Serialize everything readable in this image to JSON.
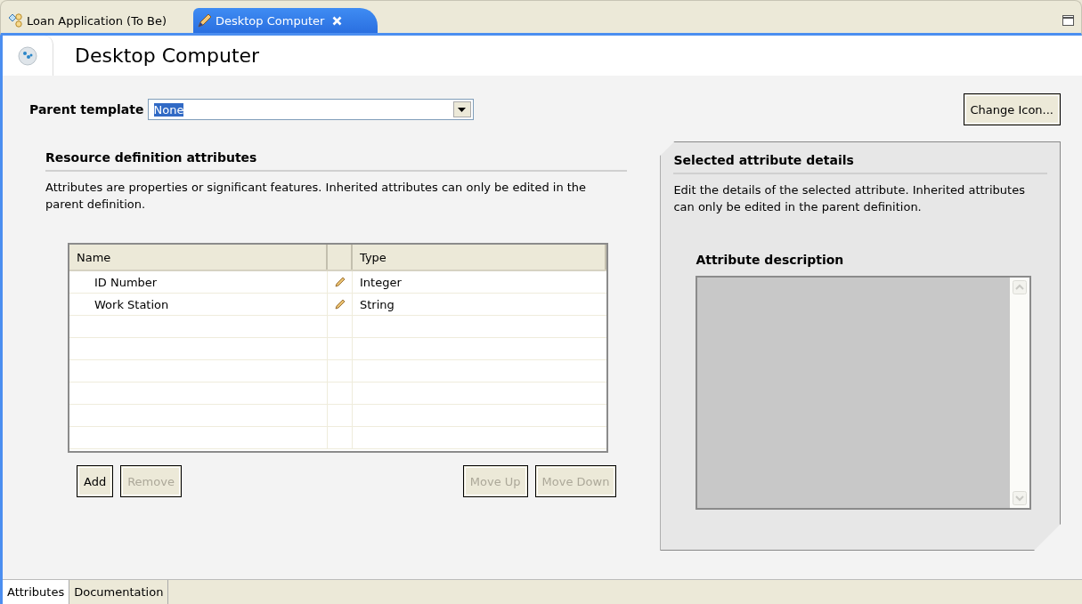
{
  "editor_tabs": [
    {
      "label": "Loan Application (To Be)",
      "selected": false,
      "kind": "process"
    },
    {
      "label": "Desktop Computer",
      "selected": true,
      "kind": "editable"
    }
  ],
  "header": {
    "title": "Desktop Computer"
  },
  "parent_template": {
    "label": "Parent template",
    "value": "None",
    "text_selected": true
  },
  "change_icon_button": {
    "label": "Change Icon...",
    "disabled": false
  },
  "resource_section": {
    "title": "Resource definition attributes",
    "description": "Attributes are properties or significant features. Inherited attributes can only be edited in the parent definition.",
    "table": {
      "columns": [
        "Name",
        "Type"
      ],
      "rows": [
        {
          "name": "ID Number",
          "type": "Integer"
        },
        {
          "name": "Work Station",
          "type": "String"
        }
      ]
    },
    "buttons": [
      {
        "label": "Add",
        "disabled": false
      },
      {
        "label": "Remove",
        "disabled": true
      },
      {
        "label": "Move Up",
        "disabled": true
      },
      {
        "label": "Move Down",
        "disabled": true
      }
    ]
  },
  "details_section": {
    "title": "Selected attribute details",
    "description": "Edit the details of the selected attribute. Inherited attributes can only be edited in the parent definition.",
    "field_label": "Attribute description",
    "field_disabled": true
  },
  "bottom_tabs": [
    {
      "label": "Attributes",
      "selected": true
    },
    {
      "label": "Documentation",
      "selected": false
    }
  ]
}
